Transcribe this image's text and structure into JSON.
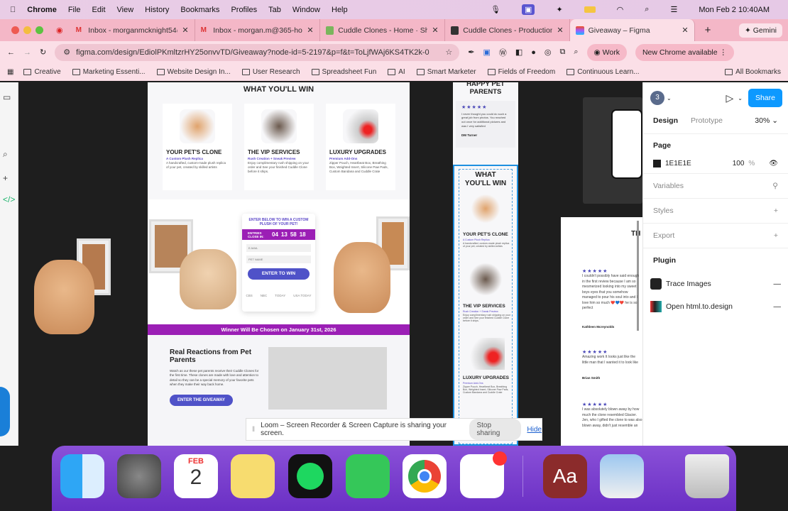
{
  "menubar": {
    "app": "Chrome",
    "items": [
      "File",
      "Edit",
      "View",
      "History",
      "Bookmarks",
      "Profiles",
      "Tab",
      "Window",
      "Help"
    ],
    "datetime": "Mon Feb 2  10:40AM"
  },
  "tabs": [
    {
      "label": "Inbox - morganmcknight54@",
      "icon": "gmail-icon"
    },
    {
      "label": "Inbox - morgan.m@365-hold",
      "icon": "gmail-icon"
    },
    {
      "label": "Cuddle Clones - Home · Shop",
      "icon": "shopify-icon"
    },
    {
      "label": "Cuddle Clones - Production",
      "icon": "app-icon"
    },
    {
      "label": "Giveaway – Figma",
      "icon": "figma-icon",
      "active": true
    }
  ],
  "gemini": "Gemini",
  "address": {
    "url": "figma.com/design/EdiolPKmltzrHY25onvvTD/Giveaway?node-id=5-2197&p=f&t=ToLjfWAj6KS4TK2k-0",
    "profile": "Work",
    "update": "New Chrome available"
  },
  "bookmarks": {
    "items": [
      "Creative",
      "Marketing Essenti...",
      "Website Design In...",
      "User Research",
      "Spreadsheet Fun",
      "AI",
      "Smart Marketer",
      "Fields of Freedom",
      "Continuous Learn..."
    ],
    "all": "All Bookmarks"
  },
  "main_frame": {
    "heading": "WHAT YOU'LL WIN",
    "cards": [
      {
        "title": "YOUR PET'S CLONE",
        "subtitle": "A Custom Plush Replica",
        "desc": "A handcrafted, custom-made plush replica of your pet, created by skilled artists"
      },
      {
        "title": "THE VIP SERVICES",
        "subtitle": "Rush Creation + Sneak Preview",
        "desc": "Enjoy complimentary rush shipping on your order and See your finished Cuddle Clone before it ships."
      },
      {
        "title": "LUXURY UPGRADES",
        "subtitle": "Premium Add-Ons",
        "desc": "Zipper Pouch, Heartbeat Box, Breathing Box, Weighted Insert, Silicone Paw Pads, Custom Bandana and Cuddle Crate"
      }
    ],
    "form": {
      "heading": "ENTER BELOW TO WIN A CUSTOM PLUSH OF YOUR PET!",
      "entries_label": "ENTRIES CLOSE IN:",
      "countdown": [
        "04",
        "13",
        "58",
        "18"
      ],
      "email_placeholder": "E-MAIL",
      "pet_placeholder": "PET NAME",
      "button": "ENTER TO WIN",
      "logos": [
        "CBS",
        "NBC",
        "TODAY",
        "USA TODAY"
      ]
    },
    "banner": "Winner Will Be Chosen on January 31st, 2026",
    "reactions": {
      "title": "Real Reactions from Pet Parents",
      "body": "Watch as our these pet parents receive their Cuddle Clones for the first time. These clones are made with love and attention to detail so they can be a special memory of your favorite pets when they make their way back home.",
      "button": "ENTER THE GIVEAWAY"
    }
  },
  "mobile_frame": {
    "top_heading": "HAPPY PET PARENTS",
    "review": "I never thought you could do such a great job from photos. You reached out once for additional pictures and was I very satisfied",
    "reviewer": "DM Turner",
    "heading": "WHAT YOU'LL WIN"
  },
  "right_frame": {
    "partial_heading": "TH",
    "reviews": [
      {
        "text": "I couldn't possibly have said enough in the first review because I am so mesmerized looking into my sweet boys eyes that you somehow managed to pour his soul into and I love him so much ❤️💙❤️ he is so perfect",
        "name": "Kathleen Mcreynolds"
      },
      {
        "text": "Amazing work It looks just like the little man that I wanted it to look like",
        "name": "Brian Smith"
      },
      {
        "text": "I was absolutely blown away by how much the clone resembled Glacier. Jen, who I gifted the clone to was also blown away, didn't just resemble an",
        "name": ""
      }
    ]
  },
  "panel": {
    "avatar": "3",
    "share": "Share",
    "tabs": [
      "Design",
      "Prototype"
    ],
    "zoom": "30%",
    "page_label": "Page",
    "page_color": "1E1E1E",
    "page_opacity": "100",
    "percent": "%",
    "sections": [
      "Variables",
      "Styles",
      "Export"
    ],
    "plugin_label": "Plugin",
    "plugins": [
      "Trace Images",
      "Open html.to.design"
    ]
  },
  "loom": {
    "message": "Loom – Screen Recorder & Screen Capture is sharing your screen.",
    "stop": "Stop sharing",
    "hide": "Hide"
  },
  "dock": {
    "calendar_month": "FEB",
    "calendar_day": "2",
    "dictionary": "Aa"
  },
  "colors": {
    "accent_purple": "#9b1fb5",
    "button_indigo": "#4f52c8",
    "figma_blue": "#0d99ff",
    "canvas": "#1E1E1E"
  }
}
